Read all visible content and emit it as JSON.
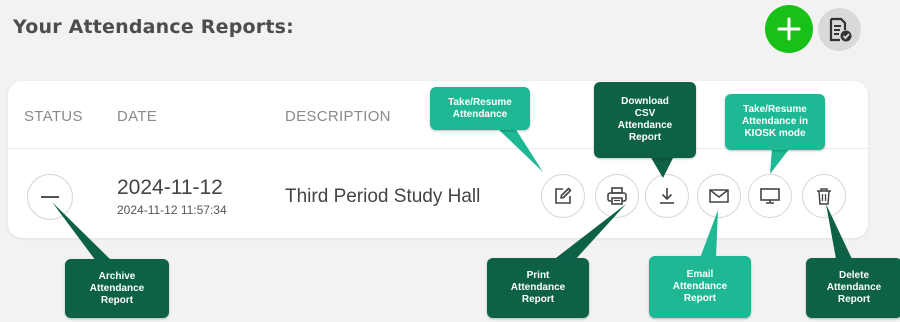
{
  "header": {
    "title": "Your Attendance Reports:"
  },
  "buttons": {
    "add": "plus-icon",
    "report": "report-check-icon"
  },
  "table": {
    "columns": [
      "STATUS",
      "DATE",
      "DESCRIPTION"
    ],
    "rows": [
      {
        "date": "2024-11-12",
        "datetime": "2024-11-12 11:57:34",
        "description": "Third Period Study Hall"
      }
    ]
  },
  "actions": [
    "edit-icon",
    "print-icon",
    "download-icon",
    "email-icon",
    "monitor-icon",
    "trash-icon"
  ],
  "callouts": {
    "take_resume": "Take/Resume\nAttendance",
    "download_csv": "Download\nCSV\nAttendance\nReport",
    "kiosk": "Take/Resume\nAttendance in\nKIOSK mode",
    "archive": "Archive\nAttendance\nReport",
    "print": "Print\nAttendance\nReport",
    "email": "Email\nAttendance\nReport",
    "delete": "Delete\nAttendance\nReport"
  },
  "colors": {
    "add_green": "#18c018",
    "callout_light": "#1fb894",
    "callout_dark": "#0c6147"
  }
}
